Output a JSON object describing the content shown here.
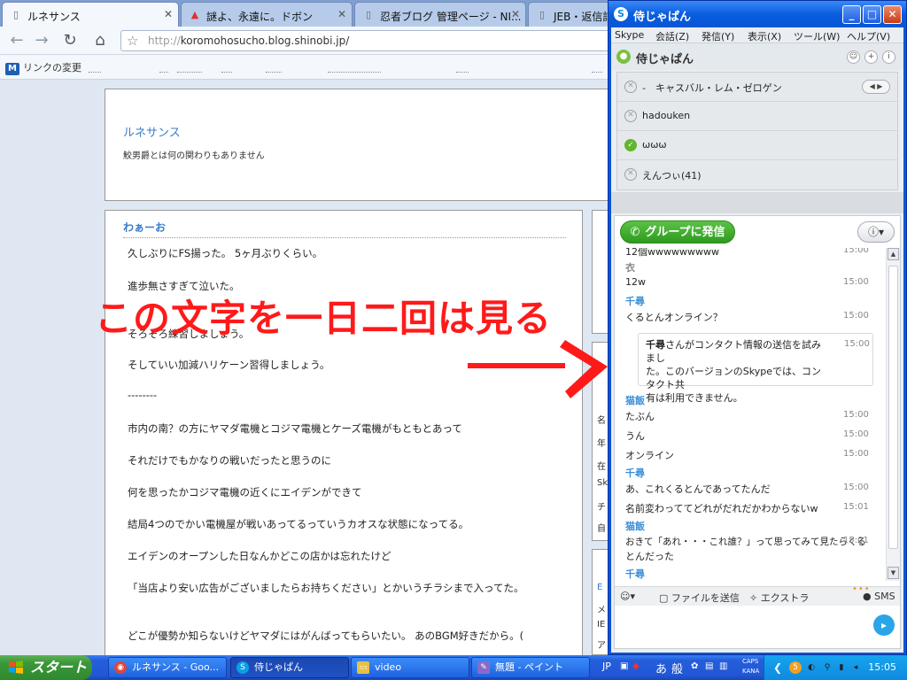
{
  "browser": {
    "tabs": [
      {
        "title": "ルネサンス",
        "active": true,
        "icon": "page-icon"
      },
      {
        "title": "謎よ、永遠に。ドボン",
        "active": false,
        "icon": "site-icon"
      },
      {
        "title": "忍者ブログ 管理ページ - NI...",
        "active": false,
        "icon": "page-icon"
      },
      {
        "title": "JEB・返信記",
        "active": false,
        "icon": "page-icon"
      }
    ],
    "url_scheme": "http://",
    "url_rest": "koromohosucho.blog.shinobi.jp/",
    "bookmark_first": "リンクの変更"
  },
  "blog": {
    "title": "ルネサンス",
    "description": "鮫男爵とは何の関わりもありません",
    "post_title": "わぁーお",
    "lines": [
      "久しぶりにFS揚った。 5ヶ月ぶりくらい。",
      "進歩無さすぎて泣いた。",
      "そろそろ練習しましょう。",
      "そしていい加減ハリケーン習得しましょう。",
      "--------",
      "市内の南？の方にヤマダ電機とコジマ電機とケーズ電機がもともとあって",
      "それだけでもかなりの戦いだったと思うのに",
      "何を思ったかコジマ電機の近くにエイデンができて",
      "結局4つのでかい電機屋が戦いあってるっていうカオスな状態になってる。",
      "エイデンのオープンした日なんかどこの店かは忘れたけど",
      "「当店より安い広告がございましたらお持ちください」とかいうチラシまで入ってた。",
      "どこが優勢か知らないけどヤマダにはがんばってもらいたい。 あのBGM好きだから。("
    ],
    "side_letters": [
      "名",
      "年",
      "在",
      "Sk",
      "チ",
      "自"
    ],
    "side_letters_lower": [
      "E",
      "メ",
      "IE",
      "ア"
    ]
  },
  "overlay": {
    "caption": "この文字を一日二回は見る",
    "accent": "#ff1a1a"
  },
  "skype": {
    "window_title": "侍じゃぱん",
    "menu": [
      "Skype",
      "会話(Z)",
      "発信(Y)",
      "表示(X)",
      "ツール(W)",
      "ヘルプ(V)"
    ],
    "group_name": "侍じゃぱん",
    "members": [
      {
        "name": "-　キャスバル・レム・ゼロゲン",
        "status": "offline"
      },
      {
        "name": "hadouken",
        "status": "offline"
      },
      {
        "name": "ωωω",
        "status": "online"
      },
      {
        "name": "えんつぃ(41)",
        "status": "offline"
      }
    ],
    "call_button": "グループに発信",
    "messages": [
      {
        "type": "text",
        "text": "12個wwwwwwwww",
        "time": "15:00"
      },
      {
        "type": "sender",
        "name": "衣",
        "gray": true
      },
      {
        "type": "text",
        "text": "12w",
        "time": "15:00"
      },
      {
        "type": "sender",
        "name": "千尋"
      },
      {
        "type": "text",
        "text": "くるとんオンライン？",
        "time": "15:00"
      },
      {
        "type": "sender",
        "name": "猫飯"
      },
      {
        "type": "text",
        "text": "たぶん",
        "time": "15:00"
      },
      {
        "type": "text",
        "text": "うん",
        "time": "15:00"
      },
      {
        "type": "text",
        "text": "オンライン",
        "time": "15:00"
      },
      {
        "type": "sender",
        "name": "千尋"
      },
      {
        "type": "text",
        "text": "あ、これくるとんであってたんだ",
        "time": "15:00"
      },
      {
        "type": "text",
        "text": "名前変わっててどれがだれだかわからないw",
        "time": "15:01"
      },
      {
        "type": "sender",
        "name": "猫飯"
      },
      {
        "type": "text",
        "text": "おきて「あれ・・・これ誰？」って思ってみて見たらくる",
        "time": "15:01"
      },
      {
        "type": "text",
        "text": "とんだった",
        "time": ""
      },
      {
        "type": "sender",
        "name": "千尋"
      }
    ],
    "system_message": {
      "name": "千尋",
      "line1": "さんがコンタクト情報の送信を試みまし",
      "line2": "た。このバージョンのSkypeでは、コンタクト共",
      "line3": "有は利用できません。",
      "time": "15:00"
    },
    "toolbar": {
      "file_send": "ファイルを送信",
      "extra": "エクストラ",
      "sms": "SMS"
    }
  },
  "taskbar": {
    "start": "スタート",
    "tasks": [
      {
        "label": "ルネサンス - Goo...",
        "icon": "chrome-icon",
        "active": false
      },
      {
        "label": "侍じゃぱん",
        "icon": "skype-icon",
        "active": true
      },
      {
        "label": "video",
        "icon": "folder-icon",
        "active": false
      },
      {
        "label": "無題 - ペイント",
        "icon": "paint-icon",
        "active": false
      }
    ],
    "lang": "JP",
    "ime_a": "あ",
    "ime_mode": "般",
    "caps": "CAPS",
    "kana": "KANA",
    "clock": "15:05"
  }
}
